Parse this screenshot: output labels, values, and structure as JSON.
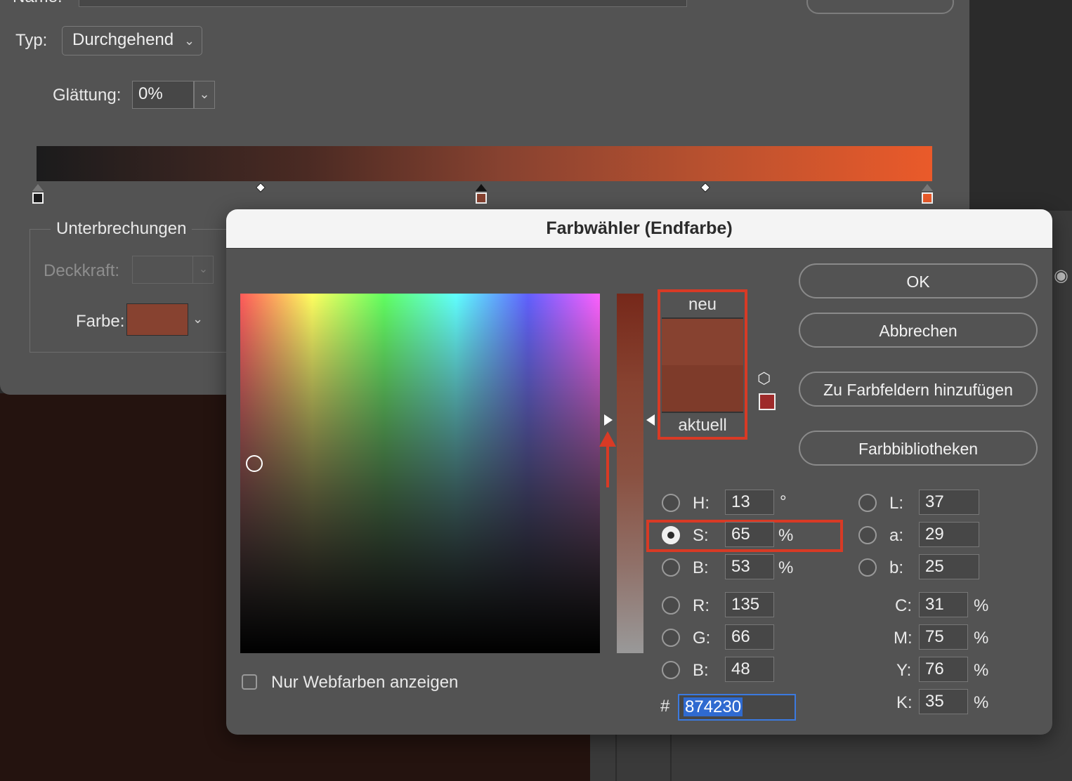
{
  "editor": {
    "name_label": "Name:",
    "typ_label": "Typ:",
    "typ_value": "Durchgehend",
    "glaettung_label": "Glättung:",
    "glaettung_value": "0%",
    "stops_group_title": "Unterbrechungen",
    "deckkraft_label": "Deckkraft:",
    "farbe_label": "Farbe:",
    "farbe_value_color": "#874230",
    "gradient_colors": [
      "#1b1b1c",
      "#874230",
      "#ea5a2a"
    ]
  },
  "picker": {
    "title": "Farbwähler (Endfarbe)",
    "preview_new_label": "neu",
    "preview_current_label": "aktuell",
    "new_color": "#874230",
    "current_color": "#7e3b2a",
    "buttons": {
      "ok": "OK",
      "cancel": "Abbrechen",
      "add_swatch": "Zu Farbfeldern hinzufügen",
      "libraries": "Farbbibliotheken"
    },
    "hsb": [
      {
        "label": "H:",
        "value": "13",
        "unit": "°",
        "selected": false
      },
      {
        "label": "S:",
        "value": "65",
        "unit": "%",
        "selected": true
      },
      {
        "label": "B:",
        "value": "53",
        "unit": "%",
        "selected": false
      }
    ],
    "rgb": [
      {
        "label": "R:",
        "value": "135"
      },
      {
        "label": "G:",
        "value": "66"
      },
      {
        "label": "B:",
        "value": "48"
      }
    ],
    "lab": [
      {
        "label": "L:",
        "value": "37"
      },
      {
        "label": "a:",
        "value": "29"
      },
      {
        "label": "b:",
        "value": "25"
      }
    ],
    "cmyk": [
      {
        "label": "C:",
        "value": "31",
        "unit": "%"
      },
      {
        "label": "M:",
        "value": "75",
        "unit": "%"
      },
      {
        "label": "Y:",
        "value": "76",
        "unit": "%"
      },
      {
        "label": "K:",
        "value": "35",
        "unit": "%"
      }
    ],
    "hex_hash": "#",
    "hex_value": "874230",
    "webcolors_label": "Nur Webfarben anzeigen",
    "webcolors_checked": false,
    "accent_color": "#d83a25"
  },
  "icons": {
    "cube": "cube-icon",
    "eye": "eye-icon",
    "chevron": "chevron-down-icon"
  }
}
